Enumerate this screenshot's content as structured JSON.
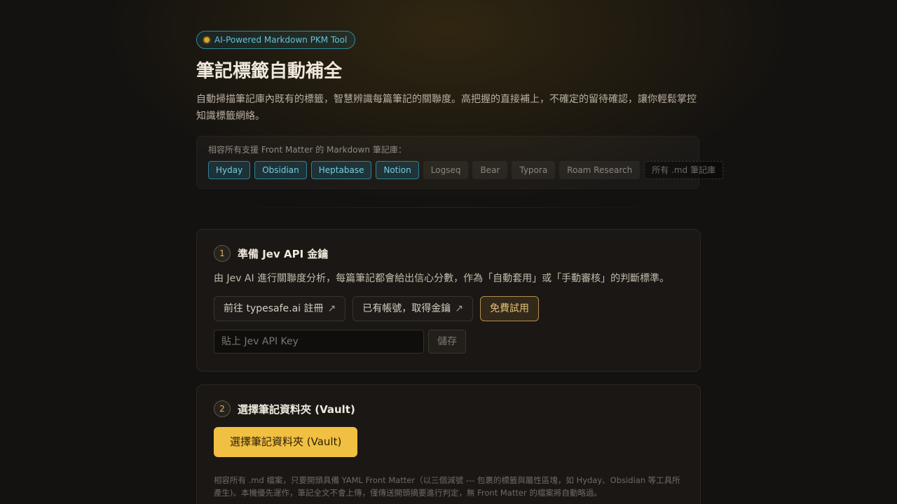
{
  "header": {
    "badge": "AI-Powered Markdown PKM Tool",
    "title": "筆記標籤自動補全",
    "description": "自動掃描筆記庫內既有的標籤，智慧辨識每篇筆記的關聯度。高把握的直接補上，不確定的留待確認，讓你輕鬆掌控知識標籤網絡。"
  },
  "compat": {
    "label": "相容所有支援 Front Matter 的 Markdown 筆記庫：",
    "chips": [
      {
        "label": "Hyday",
        "style": "active"
      },
      {
        "label": "Obsidian",
        "style": "active"
      },
      {
        "label": "Heptabase",
        "style": "active"
      },
      {
        "label": "Notion",
        "style": "active"
      },
      {
        "label": "Logseq",
        "style": "plain"
      },
      {
        "label": "Bear",
        "style": "plain"
      },
      {
        "label": "Typora",
        "style": "plain"
      },
      {
        "label": "Roam Research",
        "style": "plain"
      },
      {
        "label": "所有 .md 筆記庫",
        "style": "dashed"
      }
    ]
  },
  "step1": {
    "number": "1",
    "title": "準備 Jev API 金鑰",
    "description": "由 Jev AI 進行關聯度分析，每篇筆記都會給出信心分數，作為「自動套用」或「手動審核」的判斷標準。",
    "register_label": "前往 typesafe.ai 註冊",
    "get_key_label": "已有帳號，取得金鑰",
    "trial_label": "免費試用",
    "arrow": "↗",
    "input_placeholder": "貼上 Jev API Key",
    "save_label": "儲存"
  },
  "step2": {
    "number": "2",
    "title": "選擇筆記資料夾 (Vault)",
    "button_label": "選擇筆記資料夾 (Vault)",
    "note": "相容所有 .md 檔案，只要開頭具備 YAML Front Matter（以三個減號 --- 包裹的標籤與屬性區塊，如 Hyday、Obsidian 等工具所產生)。本機優先運作，筆記全文不會上傳，僅傳送開頭摘要進行判定，無 Front Matter 的檔案將自動略過。"
  },
  "colors": {
    "accent_gold": "#f1bf41",
    "accent_teal": "#62c3d8",
    "background": "#141210"
  }
}
